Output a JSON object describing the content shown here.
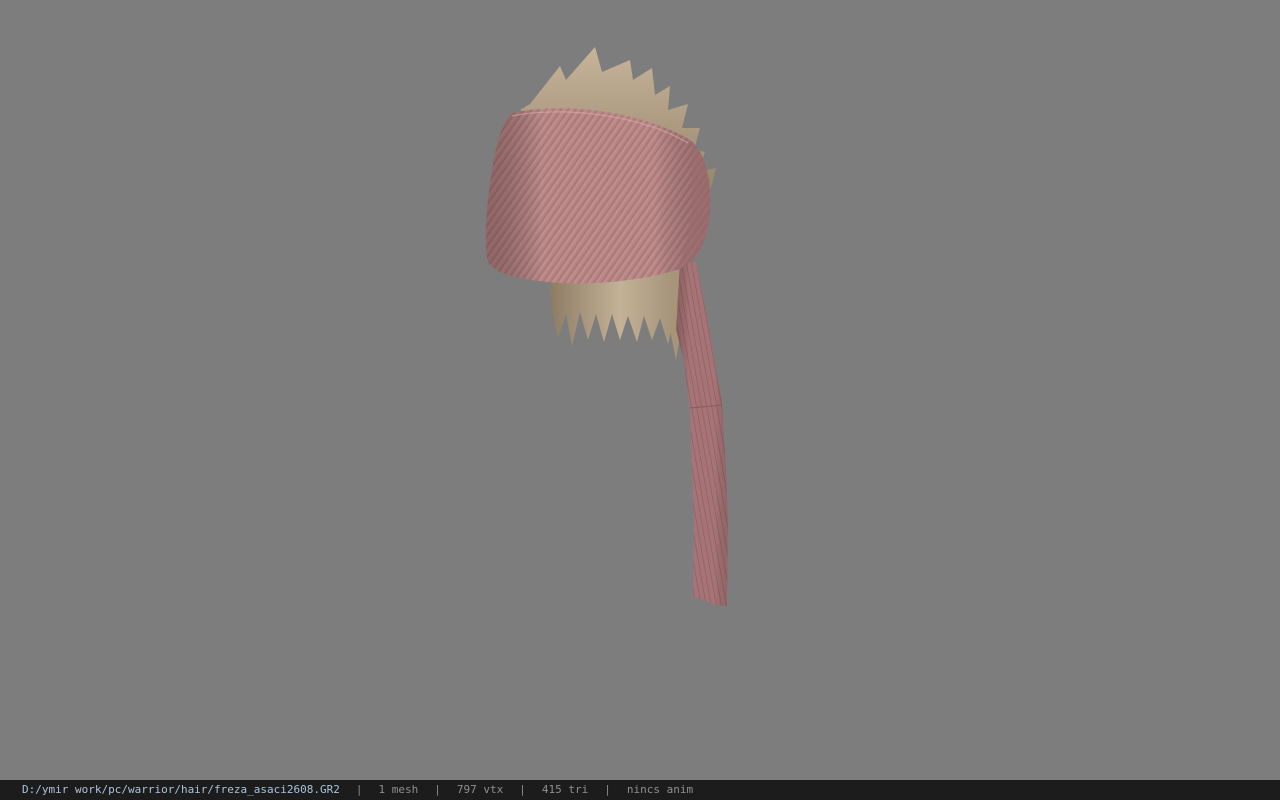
{
  "viewport": {
    "model_icon": "hair-bandana-mesh",
    "background_color": "#7d7d7d"
  },
  "status_bar": {
    "file_path": "D:/ymir work/pc/warrior/hair/freza_asaci2608.GR2",
    "separator": "|",
    "mesh_count": "1 mesh",
    "vertex_count": "797 vtx",
    "triangle_count": "415 tri",
    "anim_status": "nincs anim"
  }
}
